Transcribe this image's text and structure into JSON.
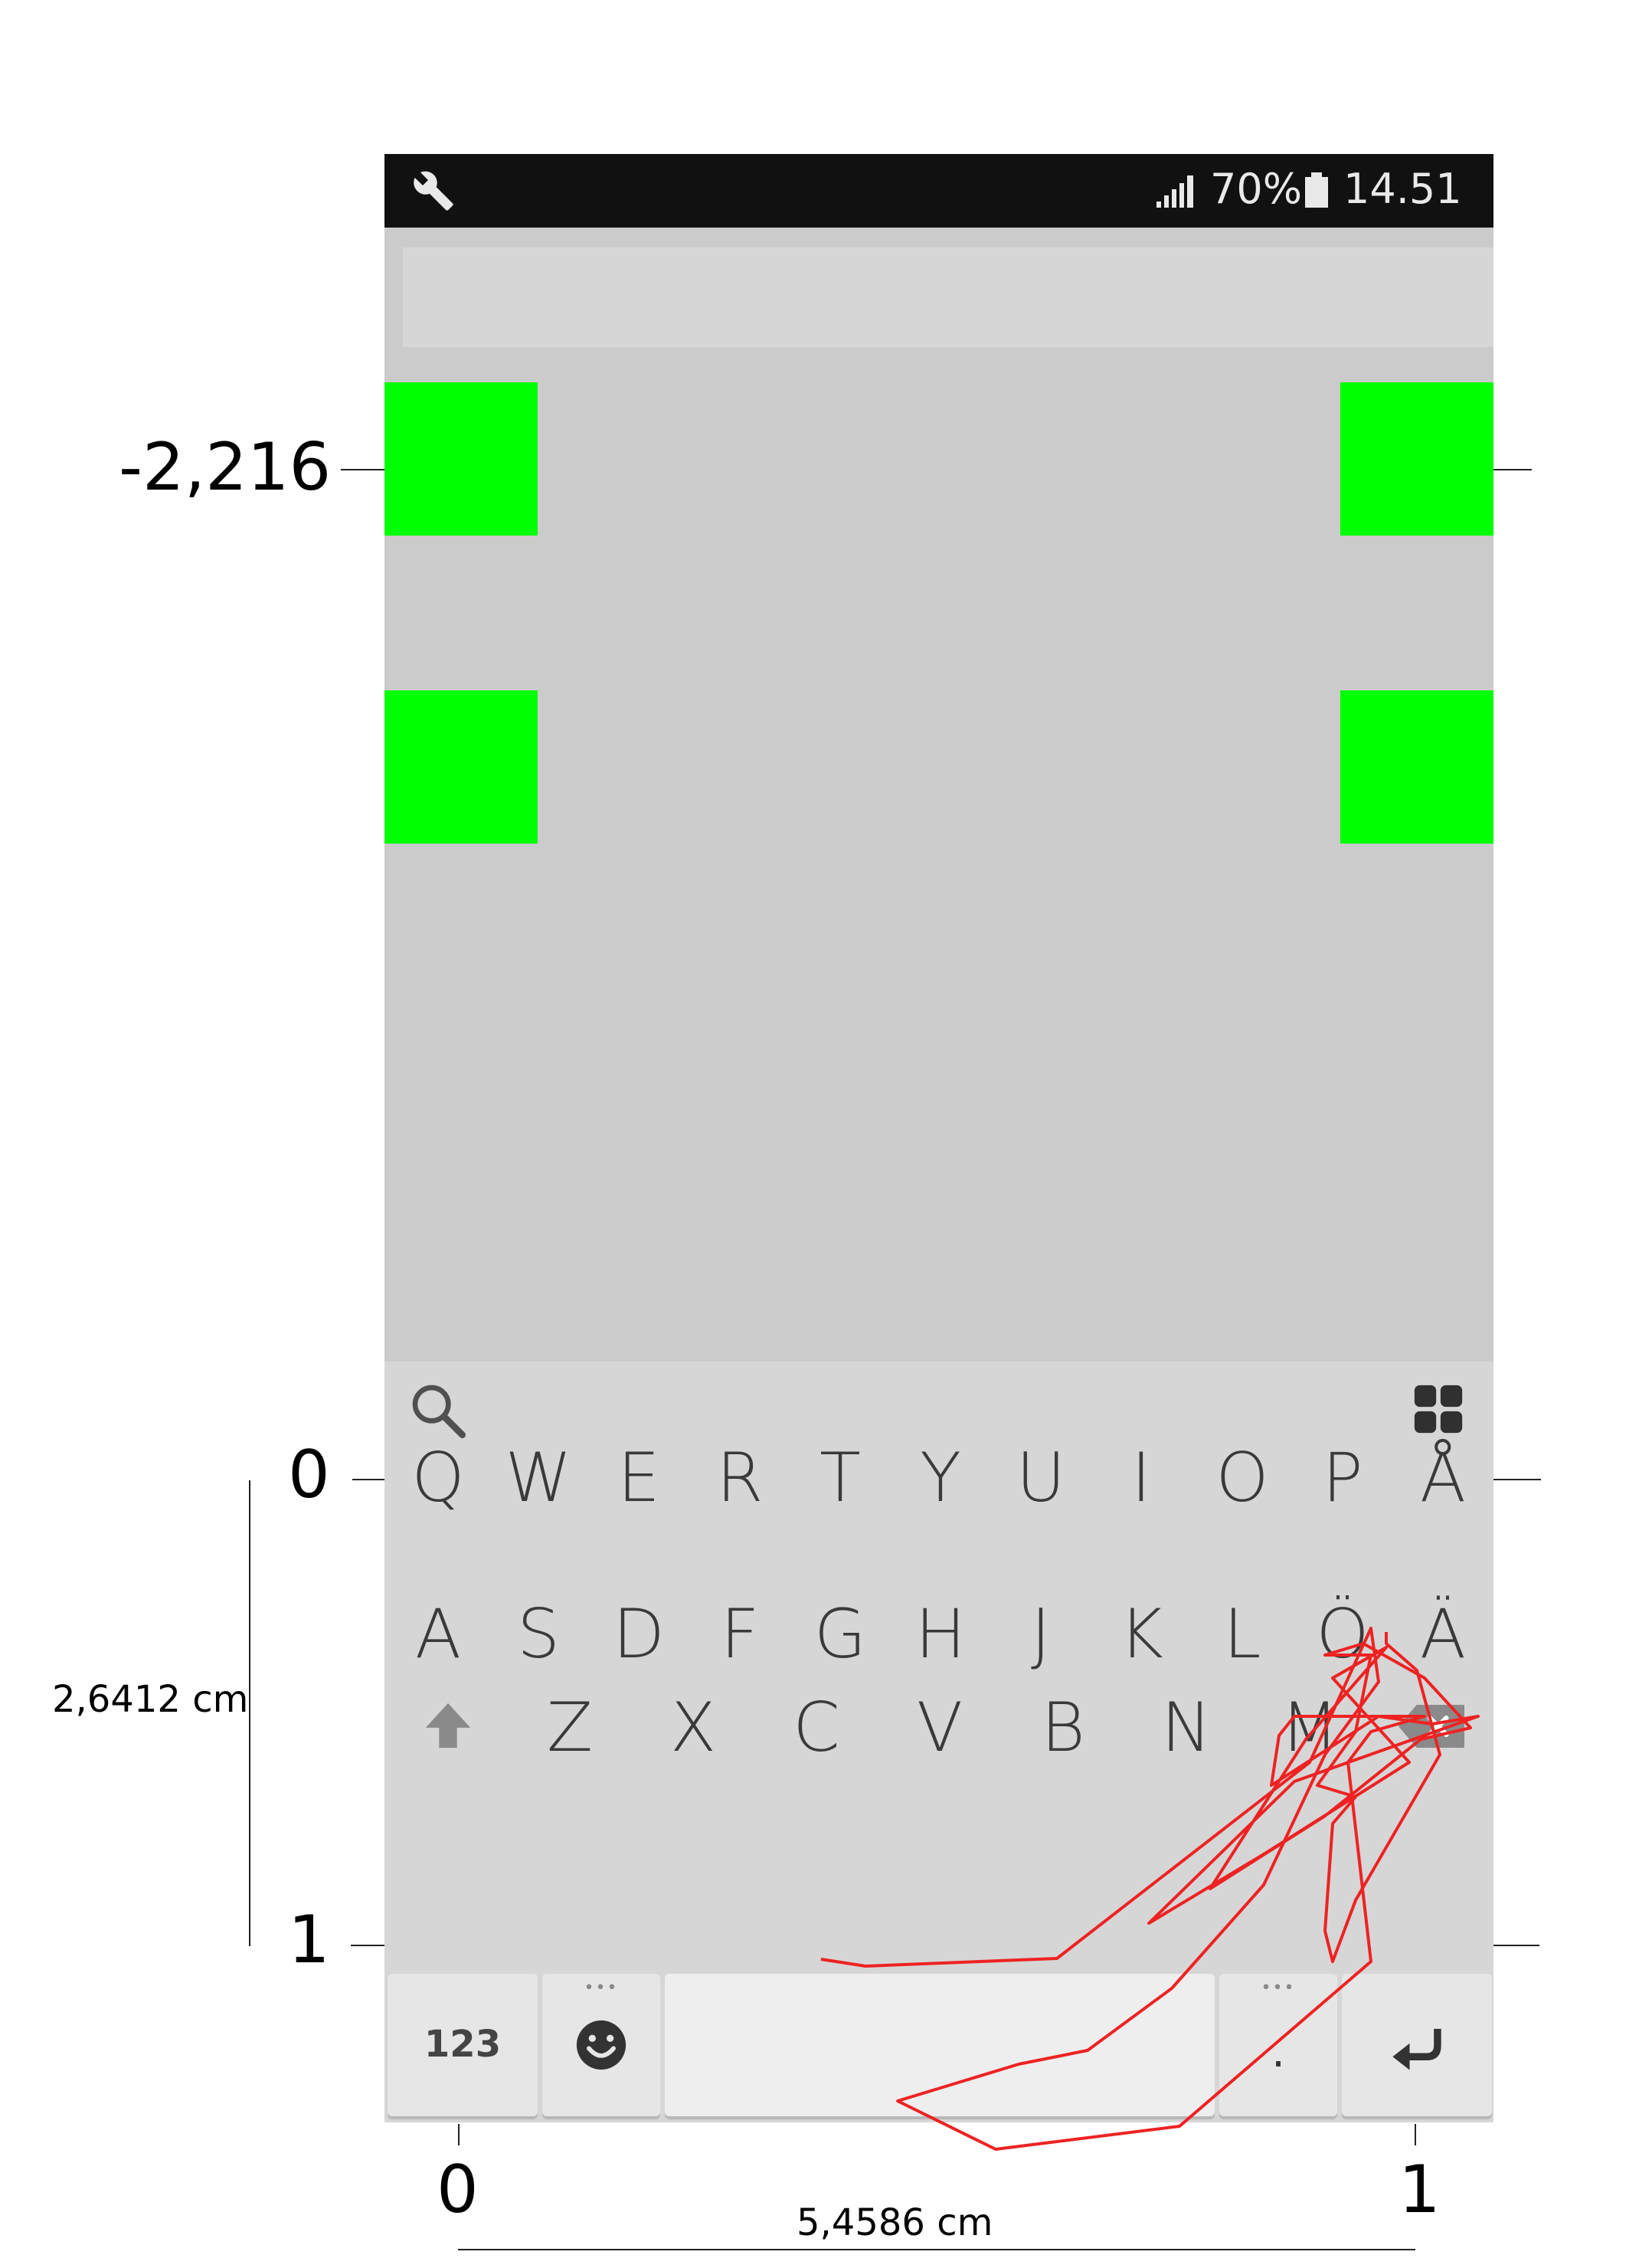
{
  "annotations": {
    "y_top_label": "-2,216",
    "y_zero_label": "0",
    "y_one_label": "1",
    "x_zero_label": "0",
    "x_one_label": "1",
    "height_label": "2,6412 cm",
    "width_label": "5,4586 cm"
  },
  "status_bar": {
    "battery": "70%",
    "time": "14.51",
    "icons": [
      "wrench-icon",
      "signal-icon",
      "battery-icon"
    ]
  },
  "keyboard": {
    "toolbar_icons": [
      "search-icon",
      "apps-grid-icon"
    ],
    "row1": [
      "Q",
      "W",
      "E",
      "R",
      "T",
      "Y",
      "U",
      "I",
      "O",
      "P",
      "Å"
    ],
    "row2": [
      "A",
      "S",
      "D",
      "F",
      "G",
      "H",
      "J",
      "K",
      "L",
      "Ö",
      "Ä"
    ],
    "row3": [
      "Z",
      "X",
      "C",
      "V",
      "B",
      "N",
      "M"
    ],
    "numeric_label": "123",
    "period_label": ".",
    "bottom_icons": [
      "emoji-icon",
      "enter-icon",
      "shift-icon",
      "backspace-icon"
    ]
  },
  "colors": {
    "target": "#00ff00",
    "trace": "#ee2222",
    "app_background": "#cbcbcb",
    "keyboard_background": "#d6d6d6"
  }
}
